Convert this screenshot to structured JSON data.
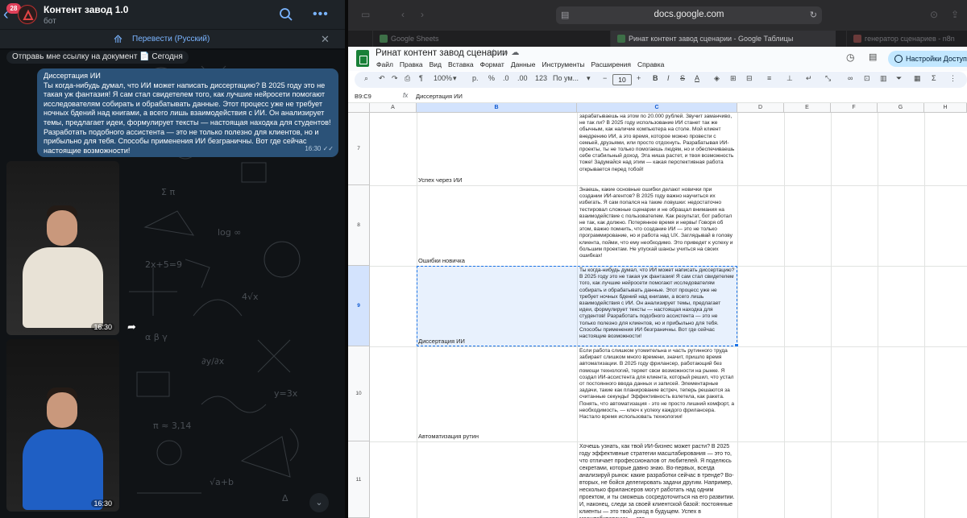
{
  "telegram": {
    "unread_badge": "28",
    "chat_title": "Контент завод 1.0",
    "chat_subtitle": "бот",
    "translate_label": "Перевести (Русский)",
    "pinned_text": "Отправь мне ссылку на документ 📄 Сегодня",
    "message": {
      "title": "Диссертация ИИ",
      "body": "Ты когда-нибудь думал, что ИИ может написать диссертацию? В 2025 году это не такая уж фантазия! Я сам стал свидетелем того, как лучшие нейросети помогают исследователям собирать и обрабатывать данные. Этот процесс уже не требует ночных бдений над книгами, а всего лишь взаимодействия с ИИ. Он анализирует темы, предлагает идеи, формулирует тексты — настоящая находка для студентов! Разработать подобного ассистента — это не только полезно для клиентов, но и прибыльно для тебя. Способы применения ИИ безграничны. Вот где сейчас настоящие возможности!",
      "time": "16:30 ✓✓"
    },
    "video1_time": "16:30",
    "video2_time": "16:30"
  },
  "browser": {
    "url": "docs.google.com",
    "tabs": [
      {
        "label": "Google Sheets"
      },
      {
        "label": "Ринат контент завод сценарии - Google Таблицы"
      },
      {
        "label": "генератор сценариев - n8n"
      }
    ]
  },
  "sheets": {
    "doc_title": "Ринат контент завод сценарии",
    "menu": [
      "Файл",
      "Правка",
      "Вид",
      "Вставка",
      "Формат",
      "Данные",
      "Инструменты",
      "Расширения",
      "Справка"
    ],
    "share_label": "Настройки Доступа",
    "toolbar": {
      "zoom": "100%",
      "currency": "р.",
      "percent": "%",
      "dec1": ".0",
      "dec2": ".00",
      "format123": "123",
      "font": "По ум...",
      "font_size": "10"
    },
    "cell_ref": "B9:C9",
    "formula_value": "Диссертация ИИ",
    "columns": [
      "A",
      "B",
      "C",
      "D",
      "E",
      "F",
      "G",
      "H"
    ],
    "rows": [
      {
        "num": "7",
        "b": "Успех через ИИ",
        "c": "зарабатываешь на этом по 20.000 рублей. Звучит заманчиво, не так ли? В 2025 году использование ИИ станет так же обычным, как наличие компьютера на столе. Мой клиент внедрению ИИ, а это время, которое можно провести с семьей, друзьями, или просто отдохнуть. Разрабатывая ИИ-проекты, ты не только помогаешь людям, но и обеспечиваешь себе стабильный доход. Эта ниша растет, и твоя возможность тоже! Задумайся над этим — какая перспективная работа открывается перед тобой!"
      },
      {
        "num": "8",
        "b": "Ошибки новичка",
        "c": "Знаешь, какие основные ошибки делают новички при создании ИИ-агентов? В 2025 году важно научиться их избегать. Я сам попался на такие ловушки: недостаточно тестировал сложные сценарии и не обращал внимания на взаимодействие с пользователем. Как результат, бот работал не так, как должно. Потерянное время и нервы! Говоря об этом, важно помнить, что создание ИИ — это не только программирование, но и работа над UX. Загляды­вай в голову клиента, пойми, что ему необходимо. Это приведет к успеху и большим проектам. Не упускай шансы учиться на своих ошибках!"
      },
      {
        "num": "9",
        "b": "Диссертация ИИ",
        "c": "Ты когда-нибудь думал, что ИИ может написать диссертацию? В 2025 году это не такая уж фантазия! Я сам стал свидетелем того, как лучшие нейросети помогают исследователям собирать и обрабатывать данные. Этот процесс уже не требует ночных бдений над книгами, а всего лишь взаимодействия с ИИ. Он анализирует темы, предлагает идеи, формулирует тексты — настоящая находка для студентов! Разработать подобного ассистента — это не только полезно для клиентов, но и прибыльно для тебя. Способы применения ИИ безграничны. Вот где сейчас настоящие возможности!"
      },
      {
        "num": "10",
        "b": "Автоматизация рутин",
        "c": "Если работа слишком утомительна и часть рутинного труда забирает слишком много времени, значит, пришло время автоматизации. В 2025 году фрилансер, работающий без помощи технологий, теряет свои возможности на рынке. Я создал ИИ-ассистента для клиента, который решил, что устал от постоянного ввода данных и записей. Элементарные задачи, такие как планирование встреч, теперь решаются за считанные секунды! Эффективность взлетела, как ракета. Понять, что автоматизация - это не просто лишний комфорт, а необходимость, — ключ к успеху каждого фрилансера. Настало время использовать технологии!"
      },
      {
        "num": "11",
        "b": "",
        "c": "Хочешь узнать, как твой ИИ-бизнес может расти? В 2025 году эффективные стратегии масштабирования — это то, что отличает профессионалов от любителей. Я поделюсь секретами, которые давно знаю. Во-первых, всегда анализируй рынок: какие разработки сейчас в тренде? Во-вторых, не бойся делегировать задачи другим. Например, несколько фрилансеров могут работать над одним проектом, и ты сможешь сосредоточиться на его развитии. И, наконец, следи за своей клиентской базой: постоянные клиенты — это твой доход в будущем. Успех в масштабировании — это..."
      }
    ]
  }
}
